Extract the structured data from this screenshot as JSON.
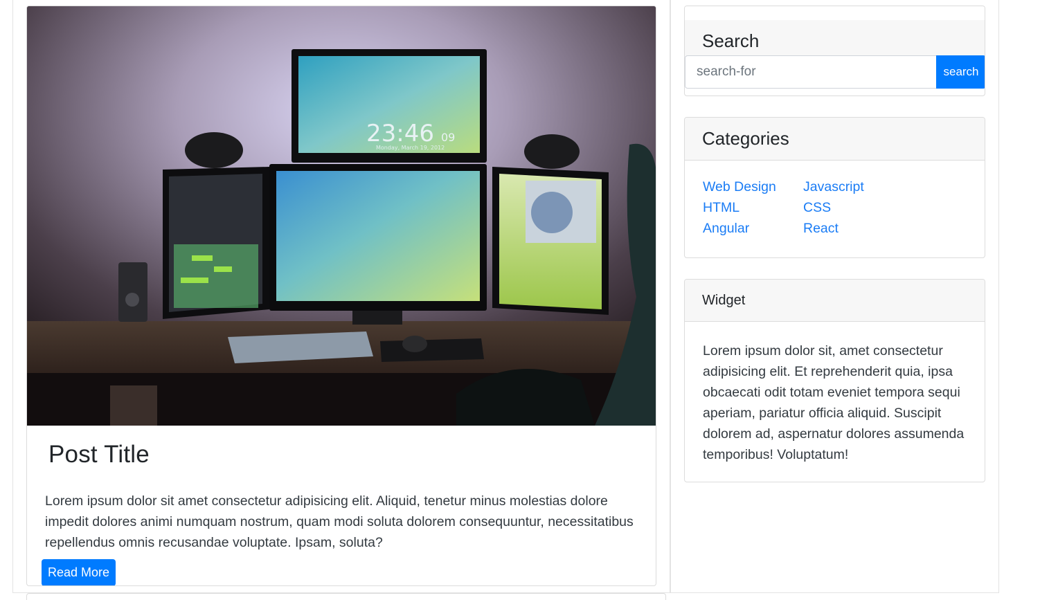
{
  "post": {
    "title": "Post Title",
    "excerpt": "Lorem ipsum dolor sit amet consectetur adipisicing elit. Aliquid, tenetur minus molestias dolore impedit dolores animi numquam nostrum, quam modi soluta dolorem consequuntur, necessitatibus repellendus omnis recusandae voluptate. Ipsam, soluta?",
    "read_more_label": "Read More",
    "image": {
      "clock_time": "23:46",
      "clock_seconds": "09",
      "clock_date": "Monday, March 19, 2012"
    }
  },
  "sidebar": {
    "search": {
      "title": "Search",
      "placeholder": "search-for",
      "button_label": "search"
    },
    "categories": {
      "title": "Categories",
      "items": [
        {
          "label": "Web Design"
        },
        {
          "label": "Javascript"
        },
        {
          "label": "HTML"
        },
        {
          "label": "CSS"
        },
        {
          "label": "Angular"
        },
        {
          "label": "React"
        }
      ]
    },
    "widget": {
      "title": "Widget",
      "body": "Lorem ipsum dolor sit, amet consectetur adipisicing elit. Et reprehenderit quia, ipsa obcaecati odit totam eveniet tempora sequi aperiam, pariatur officia aliquid. Suscipit dolorem ad, aspernatur dolores assumenda temporibus! Voluptatum!"
    }
  },
  "colors": {
    "primary": "#007bff",
    "link": "#1a7cf5",
    "card_header_bg": "#f7f7f7",
    "border": "#dcdcdc"
  }
}
